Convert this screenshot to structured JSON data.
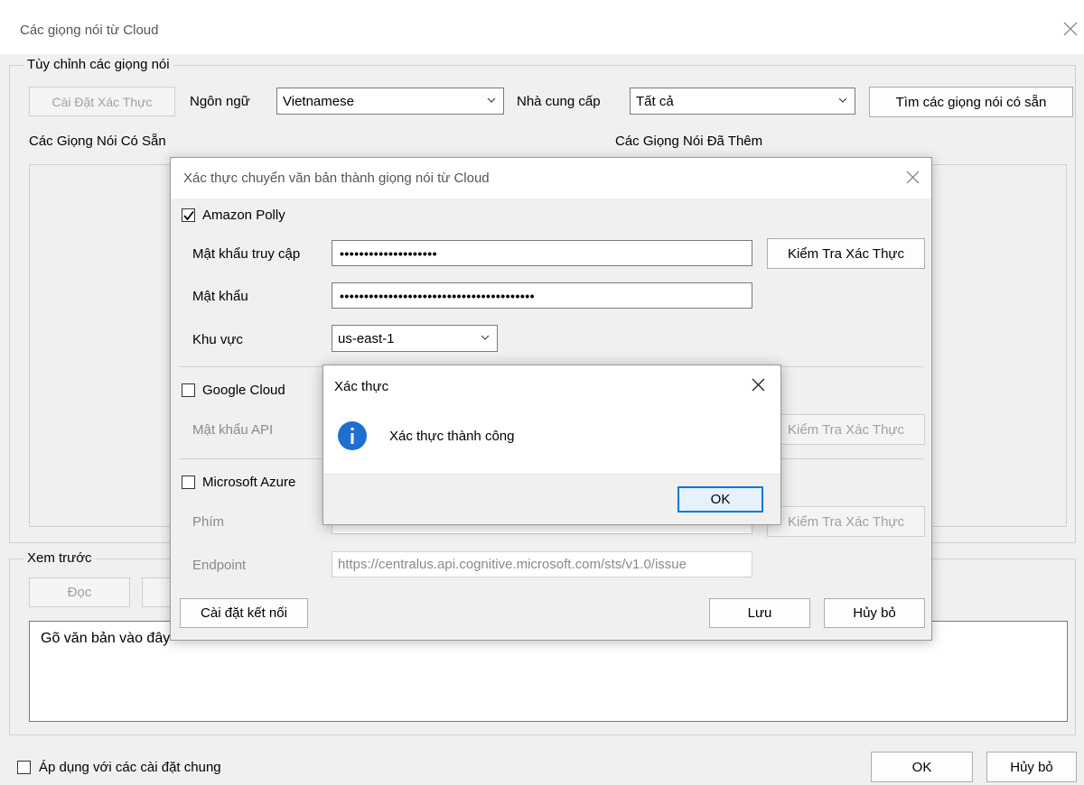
{
  "main": {
    "title": "Các giọng nói từ Cloud",
    "group_custom": "Tùy chỉnh các giọng nói",
    "auth_settings_btn": "Cài Đặt Xác Thực",
    "language_label": "Ngôn ngữ",
    "language_value": "Vietnamese",
    "provider_label": "Nhà cung cấp",
    "provider_value": "Tất cả",
    "find_btn": "Tìm các giọng nói có sẵn",
    "available_label": "Các Giọng Nói Có Sẵn",
    "added_label": "Các Giọng Nói Đã Thêm",
    "preview_group": "Xem trước",
    "read_btn": "Đọc",
    "preview_text": "Gõ văn bản vào đây",
    "apply_label": "Áp dụng với các cài đặt chung",
    "ok_btn": "OK",
    "cancel_btn": "Hủy bỏ"
  },
  "auth": {
    "title": "Xác thực chuyển văn bản thành giọng nói từ Cloud",
    "amazon_label": "Amazon Polly",
    "amazon_checked": true,
    "access_key_label": "Mật khẩu truy cập",
    "access_key_value": "••••••••••••••••••••",
    "secret_label": "Mật khẩu",
    "secret_value": "••••••••••••••••••••••••••••••••••••••••",
    "region_label": "Khu vực",
    "region_value": "us-east-1",
    "verify_btn": "Kiểm Tra Xác Thực",
    "google_label": "Google Cloud",
    "google_checked": false,
    "api_key_label": "Mật khẩu API",
    "azure_label": "Microsoft Azure",
    "azure_checked": false,
    "key_label": "Phím",
    "endpoint_label": "Endpoint",
    "endpoint_value": "https://centralus.api.cognitive.microsoft.com/sts/v1.0/issue",
    "connection_btn": "Cài đặt kết nối",
    "save_btn": "Lưu",
    "cancel_btn": "Hủy bỏ"
  },
  "msgbox": {
    "title": "Xác thực",
    "message": "Xác thực thành công",
    "ok_btn": "OK",
    "icon": "info-icon"
  }
}
